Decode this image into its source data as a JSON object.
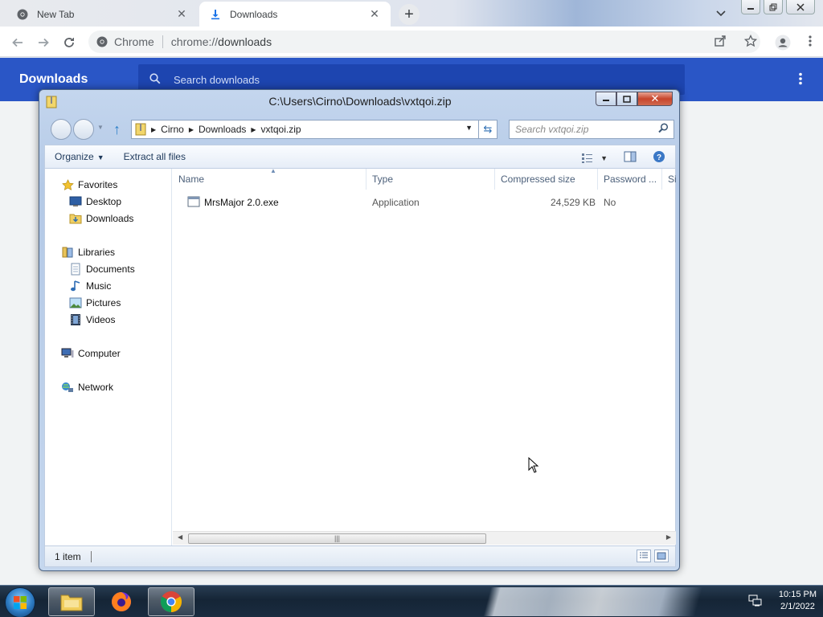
{
  "browser": {
    "tabs": [
      {
        "title": "New Tab",
        "icon": "chrome-logo-icon",
        "active": false
      },
      {
        "title": "Downloads",
        "icon": "download-icon",
        "active": true
      }
    ],
    "omnibox": {
      "chip_label": "Chrome",
      "url_scheme": "chrome://",
      "url_host": "downloads"
    }
  },
  "downloads_page": {
    "title": "Downloads",
    "search_placeholder": "Search downloads",
    "header_color": "#2a56c6"
  },
  "explorer": {
    "window_title": "C:\\Users\\Cirno\\Downloads\\vxtqoi.zip",
    "breadcrumb": [
      "Cirno",
      "Downloads",
      "vxtqoi.zip"
    ],
    "search_placeholder": "Search vxtqoi.zip",
    "commands": {
      "organize": "Organize",
      "extract": "Extract all files"
    },
    "sidebar": {
      "favorites": "Favorites",
      "desktop": "Desktop",
      "downloads": "Downloads",
      "libraries": "Libraries",
      "documents": "Documents",
      "music": "Music",
      "pictures": "Pictures",
      "videos": "Videos",
      "computer": "Computer",
      "network": "Network"
    },
    "columns": [
      "Name",
      "Type",
      "Compressed size",
      "Password ...",
      "Si"
    ],
    "files": [
      {
        "name": "MrsMajor 2.0.exe",
        "type": "Application",
        "compressed_size": "24,529 KB",
        "password": "No"
      }
    ],
    "status": "1 item"
  },
  "taskbar": {
    "time": "10:15 PM",
    "date": "2/1/2022"
  }
}
